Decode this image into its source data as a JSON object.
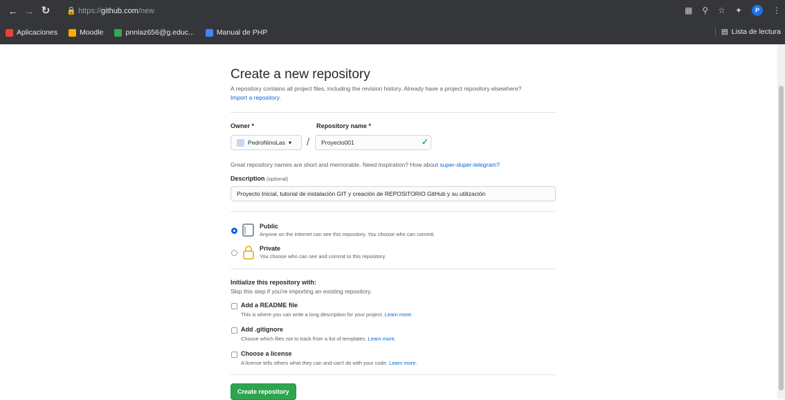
{
  "browser": {
    "url_scheme": "https://",
    "url_host": "github.com",
    "url_path": "/new",
    "bookmarks": [
      {
        "label": "Aplicaciones",
        "color": "#ea4335"
      },
      {
        "label": "Moodle",
        "color": "#f9ab00"
      },
      {
        "label": "pnnlaz656@g.educ...",
        "color": "#34a853"
      },
      {
        "label": "Manual de PHP",
        "color": "#4285f4"
      }
    ],
    "reading_list": "Lista de lectura",
    "avatar_letter": "P"
  },
  "page": {
    "title": "Create a new repository",
    "subtitle": "A repository contains all project files, including the revision history. Already have a project repository elsewhere?",
    "import_link": "Import a repository.",
    "owner_label": "Owner *",
    "owner_value": "PedroNinoLas",
    "repo_label": "Repository name *",
    "repo_value": "Proyecto001",
    "hint_text": "Great repository names are short and memorable. Need inspiration? How about",
    "hint_link": "super-duper-telegram?",
    "desc_label": "Description",
    "desc_optional": "(optional)",
    "desc_value": "Proyecto Inicial, tutorial de instalación GIT y creación de REPOSITORIO GitHub y su utilización",
    "public_title": "Public",
    "public_desc": "Anyone on the internet can see this repository. You choose who can commit.",
    "private_title": "Private",
    "private_desc": "You choose who can see and commit to this repository.",
    "init_title": "Initialize this repository with:",
    "init_sub": "Skip this step if you're importing an existing repository.",
    "readme_title": "Add a README file",
    "readme_desc": "This is where you can write a long description for your project.",
    "gitignore_title": "Add .gitignore",
    "gitignore_desc": "Choose which files not to track from a list of templates.",
    "license_title": "Choose a license",
    "license_desc": "A license tells others what they can and can't do with your code.",
    "learn_more": "Learn more.",
    "create_button": "Create repository",
    "selected_visibility": "Public"
  }
}
